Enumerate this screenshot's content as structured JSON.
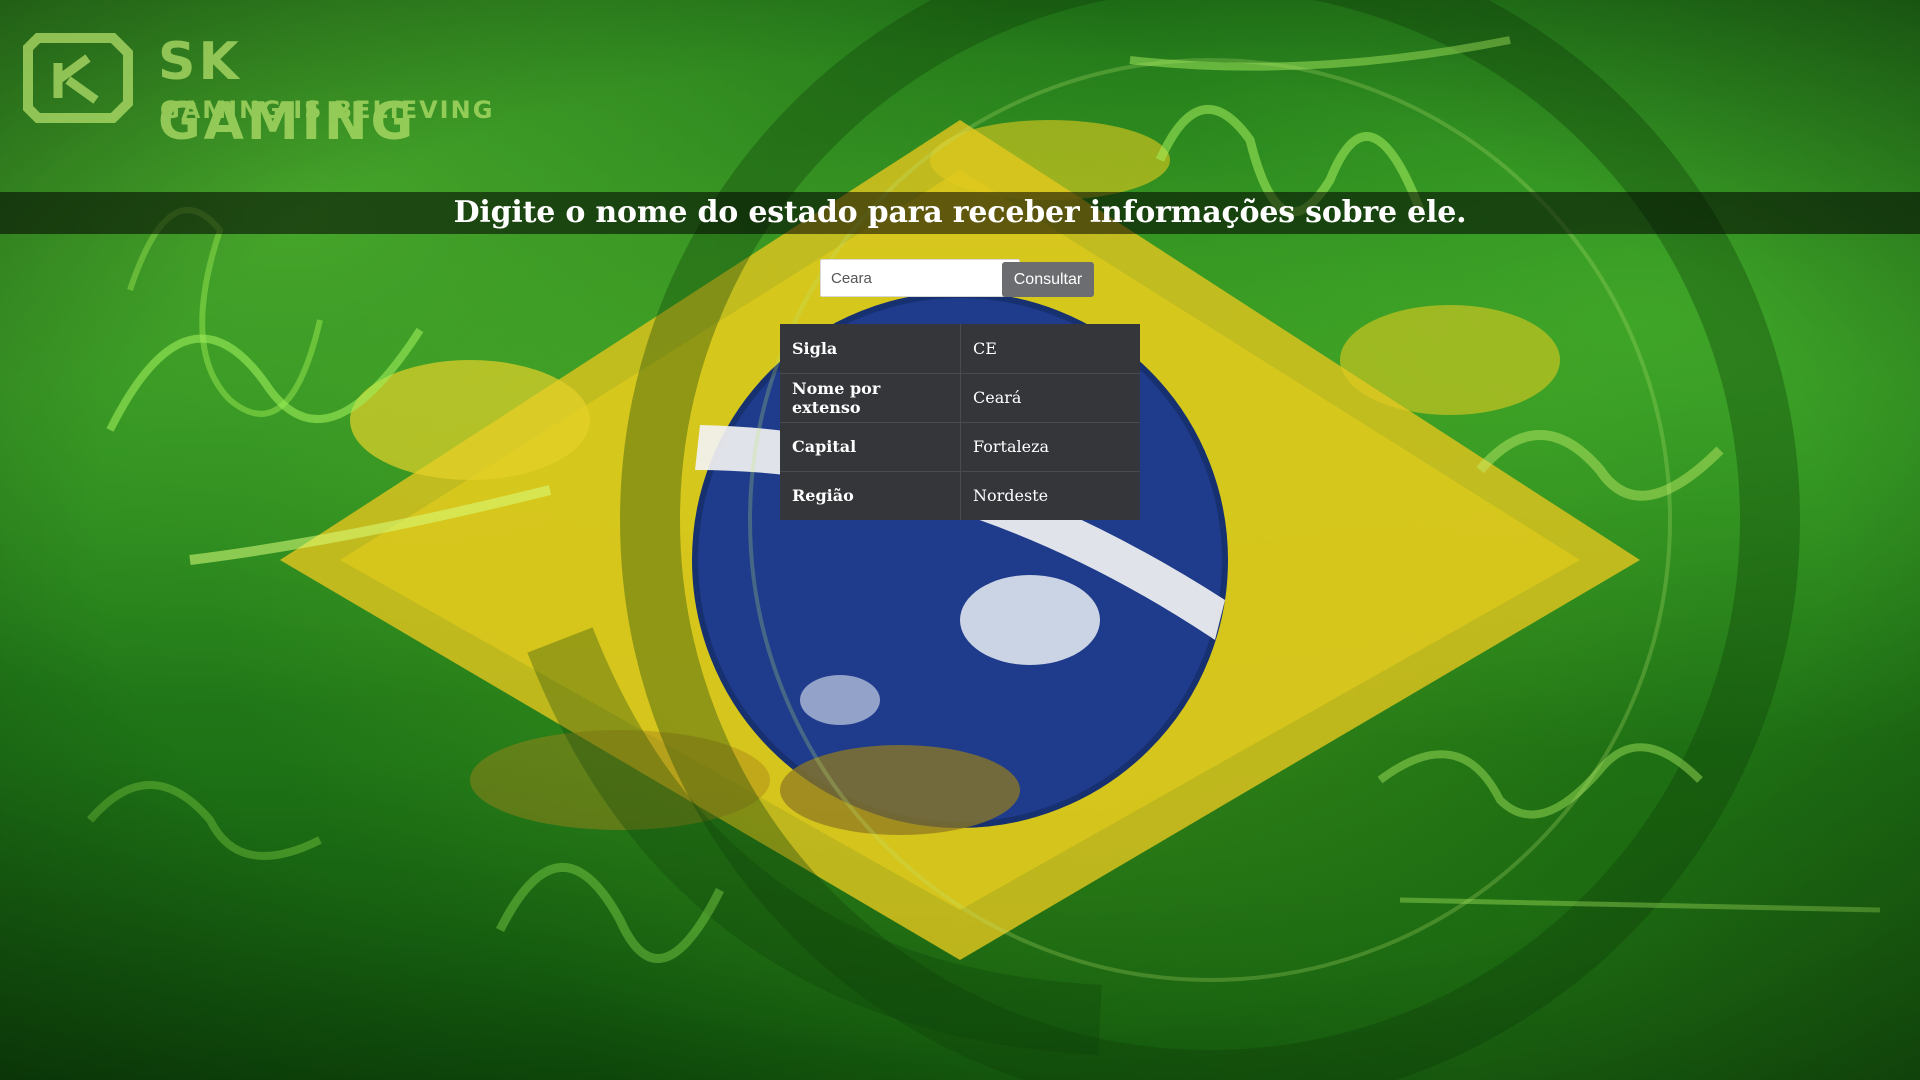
{
  "logo": {
    "title": "SK GAMING",
    "subtitle": "GAMING IS BELIEVING"
  },
  "page": {
    "title": "Digite o nome do estado para receber informações sobre ele."
  },
  "search": {
    "value": "Ceara",
    "button_label": "Consultar"
  },
  "result": {
    "rows": [
      {
        "label": "Sigla",
        "value": "CE"
      },
      {
        "label": "Nome por extenso",
        "value": "Ceará"
      },
      {
        "label": "Capital",
        "value": "Fortaleza"
      },
      {
        "label": "Região",
        "value": "Nordeste"
      }
    ]
  },
  "colors": {
    "background_green": "#1f7a1a",
    "flag_yellow": "#e8cf1c",
    "flag_blue": "#1f3c8c",
    "table_bg": "#35363a",
    "button_bg": "#6c6d70"
  }
}
